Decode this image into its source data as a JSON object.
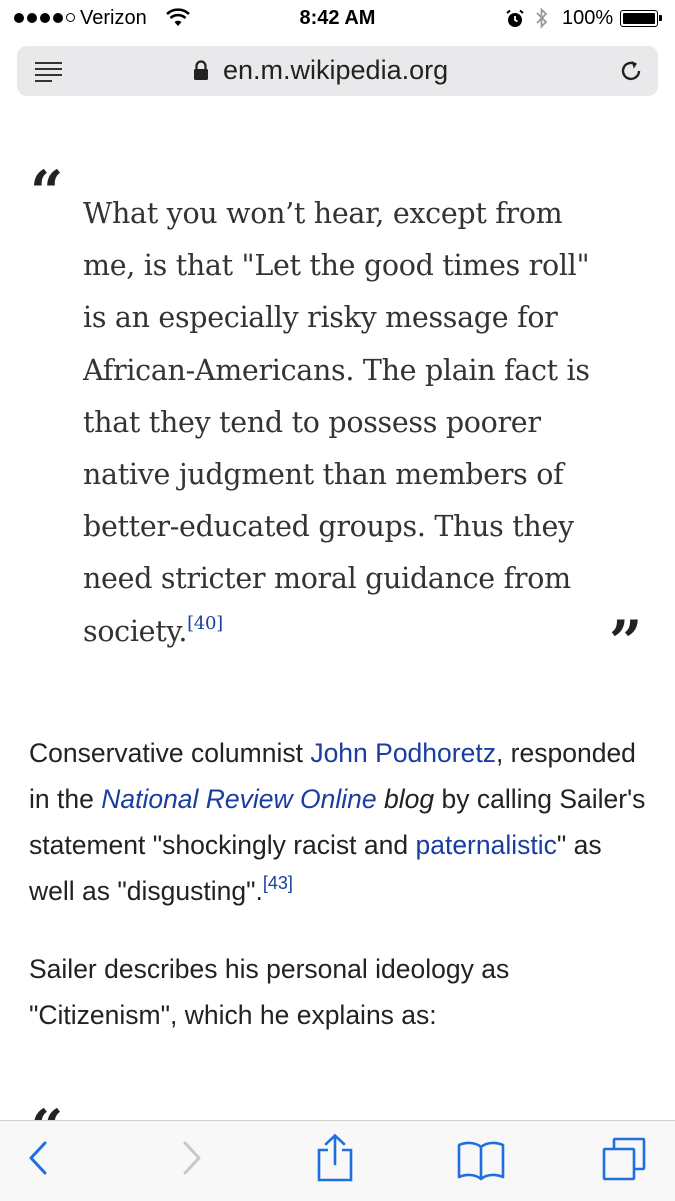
{
  "status_bar": {
    "carrier": "Verizon",
    "time": "8:42 AM",
    "battery": "100%"
  },
  "address_bar": {
    "url": "en.m.wikipedia.org"
  },
  "article": {
    "quote1_open": "“",
    "quote1_lines": [
      "What you won’t hear, except from",
      "me, is that \"Let the good times roll\"",
      "is an especially risky message for",
      "African-Americans. The plain fact is",
      "that they tend to possess poorer",
      "native judgment than members of",
      "better-educated groups. Thus they",
      "need stricter moral guidance from"
    ],
    "quote1_last": "society.",
    "quote1_ref": "[40]",
    "quote1_close": "”",
    "para1": {
      "t1": "Conservative columnist ",
      "link1": "John Podhoretz",
      "t2": ", responded in the ",
      "link2": "National Review Online",
      "t3": " blog",
      "t4": " by calling Sailer's statement \"shockingly racist and ",
      "link3": "paternalistic",
      "t5": "\" as well as \"disgusting\".",
      "ref": "[43]"
    },
    "para2": "Sailer describes his personal ideology as \"Citizenism\", which he explains as:",
    "quote2_open": "“"
  },
  "icons": {
    "menu": "reader-menu-icon",
    "lock": "lock-icon",
    "reload": "reload-icon",
    "back": "back-chevron-icon",
    "forward": "forward-chevron-icon",
    "share": "share-icon",
    "bookmarks": "bookmarks-icon",
    "tabs": "tabs-icon"
  },
  "colors": {
    "link": "#1a3ea0",
    "toolbar_icon": "#1f6fe0"
  }
}
